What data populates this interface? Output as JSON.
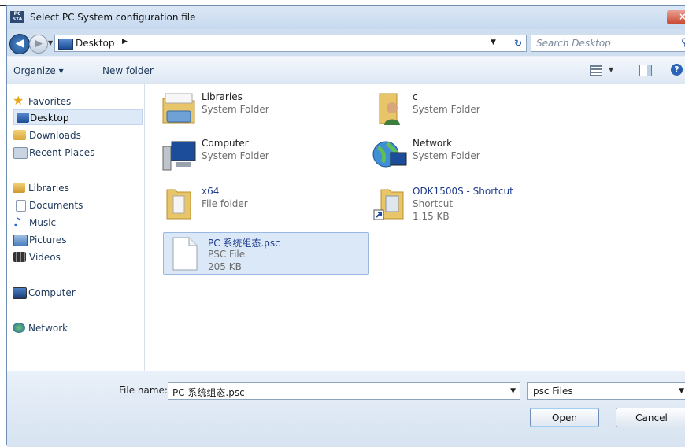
{
  "window": {
    "title": "Select PC System configuration file",
    "app_icon_text": "PC STA",
    "close_glyph": "×"
  },
  "nav": {
    "back_glyph": "◀",
    "forward_glyph": "▶",
    "location": "Desktop",
    "separator": "▶",
    "refresh_glyph": "↻",
    "search_placeholder": "Search Desktop"
  },
  "toolbar": {
    "organize": "Organize ▾",
    "new_folder": "New folder",
    "help": "?"
  },
  "sidebar": {
    "favorites": "Favorites",
    "desktop": "Desktop",
    "downloads": "Downloads",
    "recent_places": "Recent Places",
    "libraries": "Libraries",
    "documents": "Documents",
    "music": "Music",
    "pictures": "Pictures",
    "videos": "Videos",
    "computer": "Computer",
    "network": "Network"
  },
  "items": [
    {
      "name": "Libraries",
      "sub1": "System Folder",
      "sub2": ""
    },
    {
      "name": "c",
      "sub1": "System Folder",
      "sub2": ""
    },
    {
      "name": "Computer",
      "sub1": "System Folder",
      "sub2": ""
    },
    {
      "name": "Network",
      "sub1": "System Folder",
      "sub2": ""
    },
    {
      "name": "x64",
      "sub1": "File folder",
      "sub2": ""
    },
    {
      "name": "ODK1500S - Shortcut",
      "sub1": "Shortcut",
      "sub2": "1.15 KB"
    },
    {
      "name": "PC 系统组态.psc",
      "sub1": "PSC File",
      "sub2": "205 KB"
    }
  ],
  "bottom": {
    "file_name_label": "File name:",
    "file_name_value": "PC 系统组态.psc",
    "file_type": "psc Files",
    "open": "Open",
    "cancel": "Cancel",
    "dropdown_glyph": "▼"
  }
}
